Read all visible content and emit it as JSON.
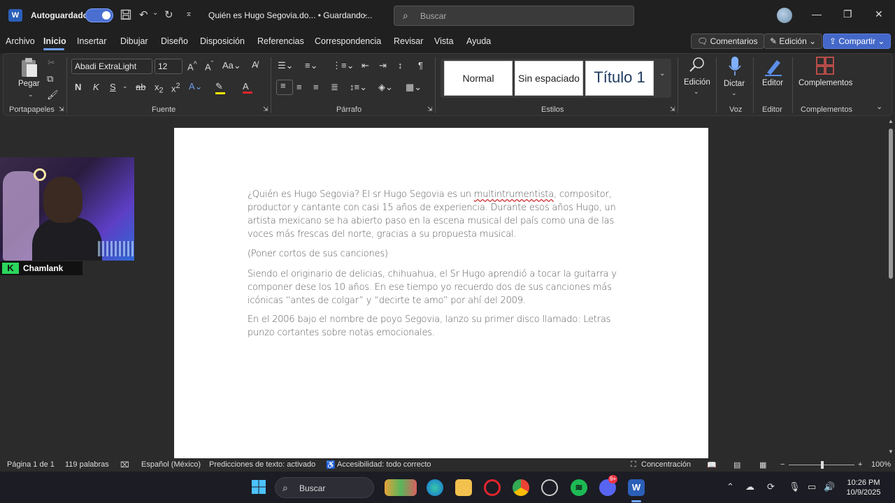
{
  "titlebar": {
    "app_letter": "W",
    "autosave_label": "Autoguardado",
    "doc_title": "Quién es Hugo Segovia.do... • Guardando...",
    "search_placeholder": "Buscar"
  },
  "menu": {
    "tabs": [
      "Archivo",
      "Inicio",
      "Insertar",
      "Dibujar",
      "Diseño",
      "Disposición",
      "Referencias",
      "Correspondencia",
      "Revisar",
      "Vista",
      "Ayuda"
    ],
    "active_tab": "Inicio",
    "comments_label": "Comentarios",
    "editing_label": "Edición",
    "share_label": "Compartir"
  },
  "ribbon": {
    "paste_label": "Pegar",
    "font_name": "Abadi ExtraLight",
    "font_size": "12",
    "bold": "N",
    "italic": "K",
    "underline": "S",
    "styles": [
      "Normal",
      "Sin espaciado",
      "Título 1"
    ],
    "edicion_label": "Edición",
    "dictar_label": "Dictar",
    "editor_label": "Editor",
    "complementos_label": "Complementos",
    "groups": {
      "portapapeles": "Portapapeles",
      "fuente": "Fuente",
      "parrafo": "Párrafo",
      "estilos": "Estilos",
      "voz": "Voz",
      "editor": "Editor",
      "complementos": "Complementos"
    }
  },
  "document": {
    "p1_before": "¿Quién es Hugo Segovia? El sr Hugo Segovia es un ",
    "p1_misspelled": "multintrumentista",
    "p1_after": ", compositor, productor y cantante con casi 15 años de experiencia. Durante esos años Hugo, un artista mexicano se ha abierto paso en la escena musical del país como una de las voces más frescas del norte, gracias a su propuesta musical.",
    "p2": "(Poner cortos de sus canciones)",
    "p3": "Siendo el originario de delicias, chihuahua, el Sr Hugo aprendió a tocar la guitarra y componer dese los 10 años. En ese tiempo yo recuerdo dos de sus canciones más icónicas “antes de colgar” y “decirte te amo” por ahí del 2009.",
    "p4": "En el 2006 bajo el nombre de poyo Segovia, lanzo su primer disco llamado: Letras punzo cortantes sobre notas emocionales."
  },
  "webcam": {
    "logo_letter": "K",
    "channel_name": "Chamlank"
  },
  "statusbar": {
    "page": "Página 1 de 1",
    "words": "119 palabras",
    "language": "Español (México)",
    "predictions": "Predicciones de texto: activado",
    "accessibility": "Accesibilidad: todo correcto",
    "focus": "Concentración",
    "zoom": "100%"
  },
  "taskbar": {
    "search_label": "Buscar",
    "discord_badge": "9+",
    "time": "10:26 PM",
    "date": "10/9/2025"
  }
}
